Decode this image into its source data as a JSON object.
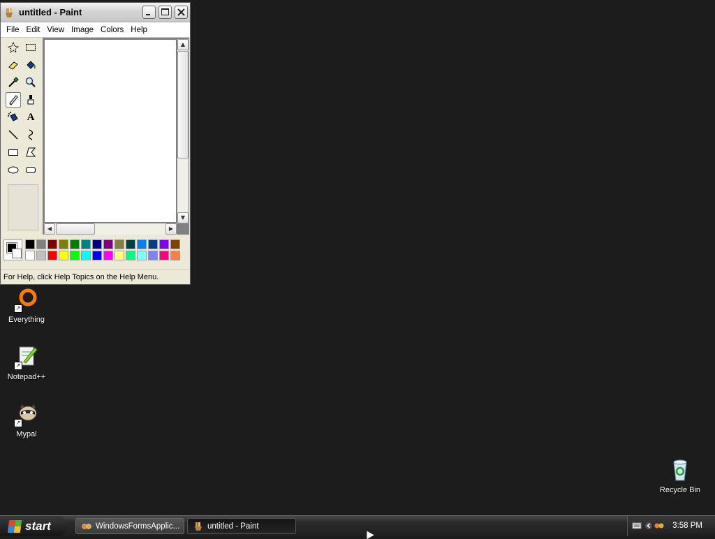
{
  "window": {
    "title": "untitled - Paint",
    "menu": [
      "File",
      "Edit",
      "View",
      "Image",
      "Colors",
      "Help"
    ],
    "status": "For Help, click Help Topics on the Help Menu."
  },
  "tools": [
    {
      "name": "free-form-select-icon"
    },
    {
      "name": "select-icon"
    },
    {
      "name": "eraser-icon"
    },
    {
      "name": "fill-icon"
    },
    {
      "name": "pick-color-icon"
    },
    {
      "name": "magnifier-icon"
    },
    {
      "name": "pencil-icon",
      "selected": true
    },
    {
      "name": "brush-icon"
    },
    {
      "name": "airbrush-icon"
    },
    {
      "name": "text-icon"
    },
    {
      "name": "line-icon"
    },
    {
      "name": "curve-icon"
    },
    {
      "name": "rectangle-icon"
    },
    {
      "name": "polygon-icon"
    },
    {
      "name": "ellipse-icon"
    },
    {
      "name": "rounded-rectangle-icon"
    }
  ],
  "palette": {
    "foreground": "#000000",
    "background": "#ffffff",
    "row1": [
      "#000000",
      "#808080",
      "#800000",
      "#808000",
      "#008000",
      "#008080",
      "#000080",
      "#800080",
      "#808040",
      "#004040",
      "#0080ff",
      "#004080",
      "#8000ff",
      "#804000"
    ],
    "row2": [
      "#ffffff",
      "#c0c0c0",
      "#ff0000",
      "#ffff00",
      "#00ff00",
      "#00ffff",
      "#0000ff",
      "#ff00ff",
      "#ffff80",
      "#00ff80",
      "#80ffff",
      "#8080ff",
      "#ff0080",
      "#ff8040"
    ]
  },
  "desktop": {
    "icons": [
      {
        "label": "Everything",
        "icon": "everything-icon"
      },
      {
        "label": "Notepad++",
        "icon": "notepad-plus-plus-icon"
      },
      {
        "label": "Mypal",
        "icon": "mypal-icon"
      },
      {
        "label": "Recycle Bin",
        "icon": "recycle-bin-icon"
      }
    ]
  },
  "taskbar": {
    "start_label": "start",
    "tasks": [
      {
        "label": "WindowsFormsApplic...",
        "icon": "windows-forms-app-icon"
      },
      {
        "label": "untitled - Paint",
        "icon": "paint-icon",
        "active": true
      }
    ],
    "clock": "3:58 PM"
  }
}
